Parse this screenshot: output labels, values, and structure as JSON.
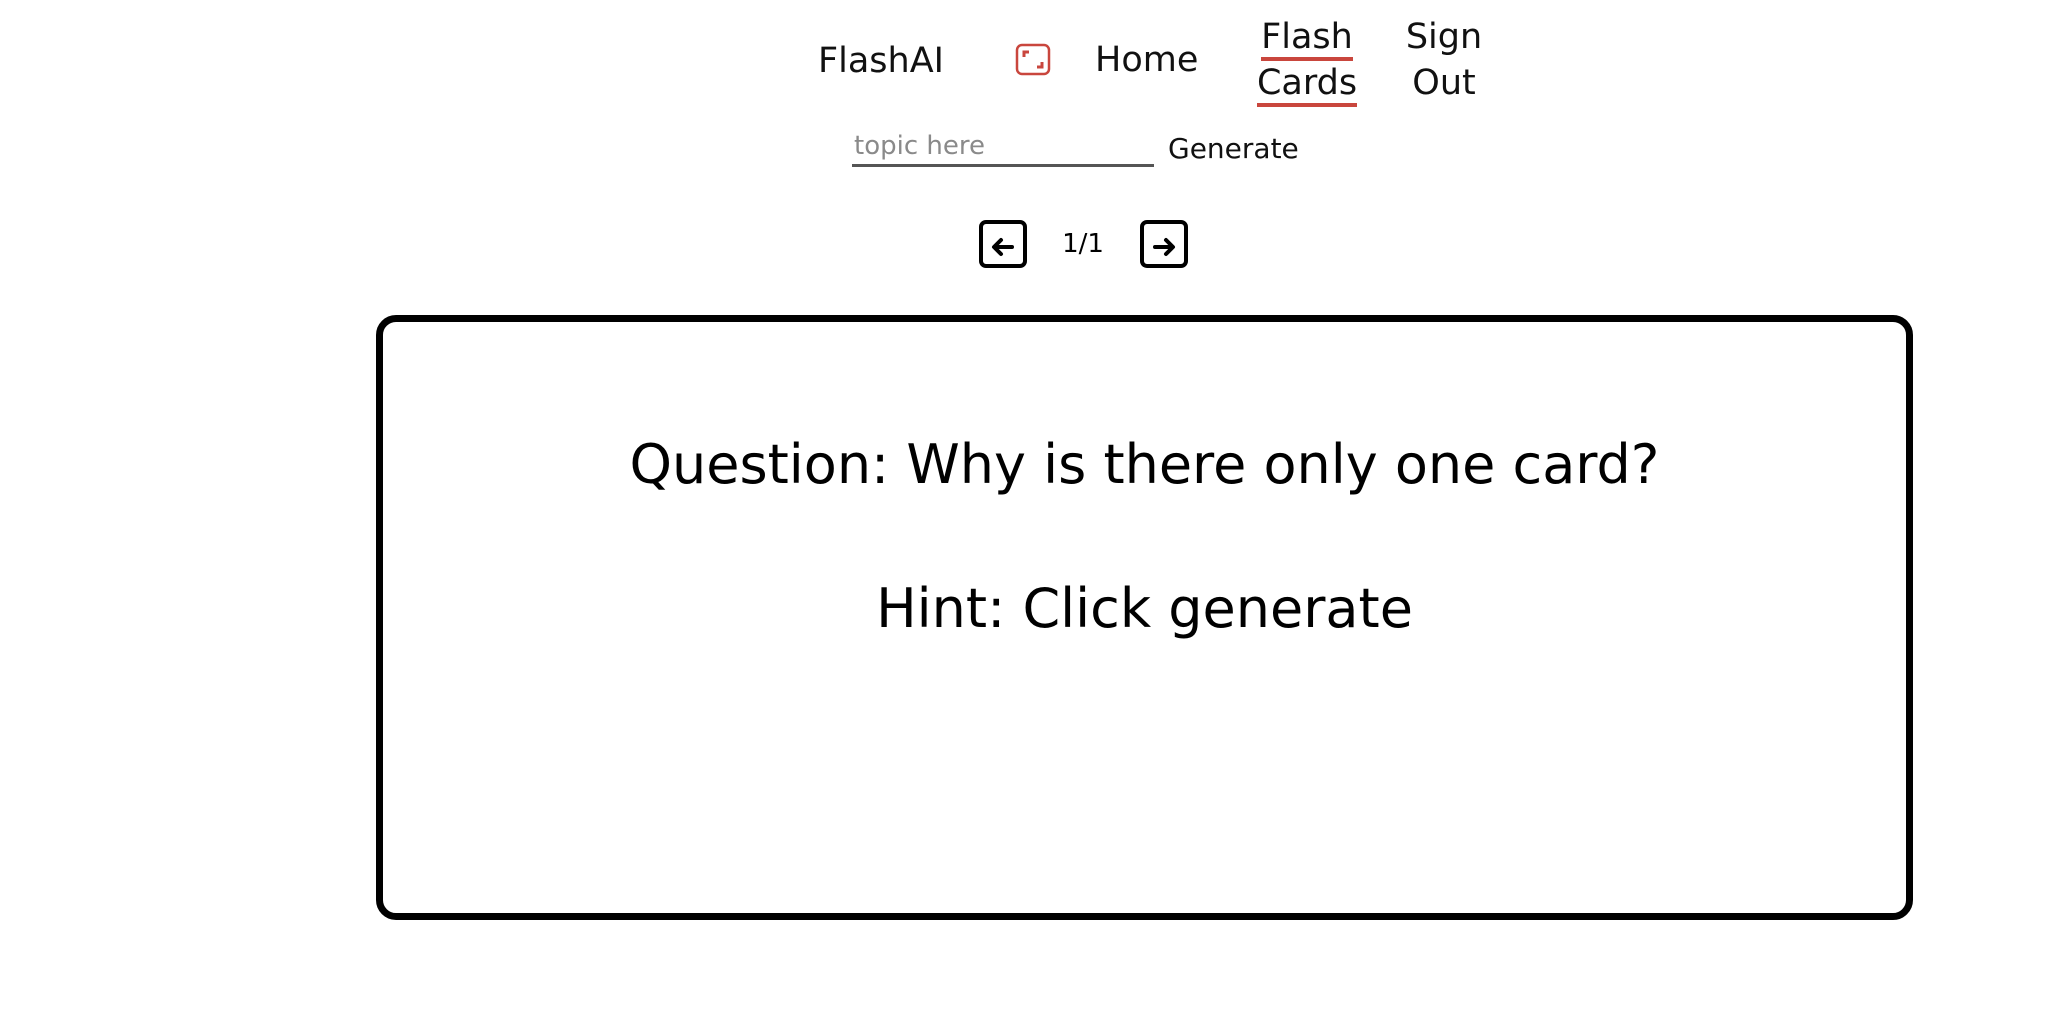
{
  "nav": {
    "brand": "FlashAI",
    "mode_icon": "fullscreen-icon",
    "home_label": "Home",
    "flash_line1": "Flash",
    "flash_line2": "Cards",
    "signout_line1": "Sign",
    "signout_line2": "Out",
    "accent_color": "#c9463d"
  },
  "generator": {
    "placeholder": "topic here",
    "value": "",
    "button_label": "Generate"
  },
  "pager": {
    "prev_icon": "arrow-left-icon",
    "next_icon": "arrow-right-icon",
    "count": "1/1"
  },
  "card": {
    "question": "Question: Why is there only one card?",
    "hint": "Hint: Click generate"
  }
}
